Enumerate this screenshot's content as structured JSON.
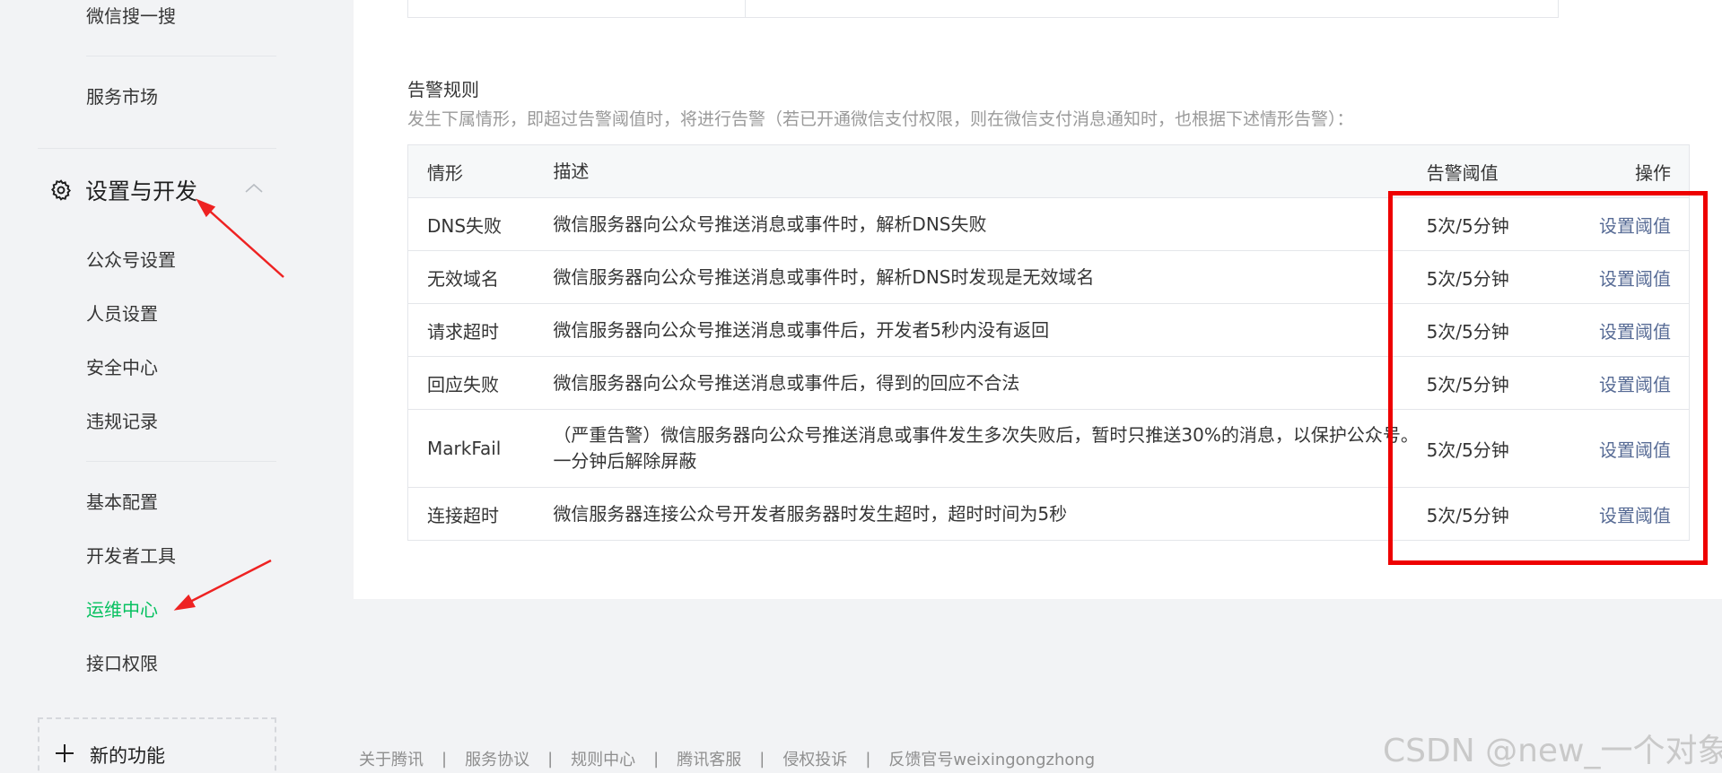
{
  "sidebar": {
    "top_items": [
      "微信搜一搜",
      "服务市场"
    ],
    "section": {
      "title": "设置与开发",
      "icon": "gear-icon",
      "collapse_icon": "chevron-up-icon"
    },
    "group1": [
      "公众号设置",
      "人员设置",
      "安全中心",
      "违规记录"
    ],
    "group2": [
      "基本配置",
      "开发者工具",
      "运维中心",
      "接口权限"
    ],
    "active_item": "运维中心",
    "new_feature": "新的功能"
  },
  "main": {
    "title": "告警规则",
    "description": "发生下属情形，即超过告警阈值时，将进行告警（若已开通微信支付权限，则在微信支付消息通知时，也根据下述情形告警）：",
    "columns": [
      "情形",
      "描述",
      "告警阈值",
      "操作"
    ],
    "rows": [
      {
        "name": "DNS失败",
        "desc": "微信服务器向公众号推送消息或事件时，解析DNS失败",
        "threshold": "5次/5分钟",
        "action": "设置阈值"
      },
      {
        "name": "无效域名",
        "desc": "微信服务器向公众号推送消息或事件时，解析DNS时发现是无效域名",
        "threshold": "5次/5分钟",
        "action": "设置阈值"
      },
      {
        "name": "请求超时",
        "desc": "微信服务器向公众号推送消息或事件后，开发者5秒内没有返回",
        "threshold": "5次/5分钟",
        "action": "设置阈值"
      },
      {
        "name": "回应失败",
        "desc": "微信服务器向公众号推送消息或事件后，得到的回应不合法",
        "threshold": "5次/5分钟",
        "action": "设置阈值"
      },
      {
        "name": "MarkFail",
        "desc": "（严重告警）微信服务器向公众号推送消息或事件发生多次失败后，暂时只推送30%的消息，以保护公众号。一分钟后解除屏蔽",
        "threshold": "5次/5分钟",
        "action": "设置阈值"
      },
      {
        "name": "连接超时",
        "desc": "微信服务器连接公众号开发者服务器时发生超时，超时时间为5秒",
        "threshold": "5次/5分钟",
        "action": "设置阈值"
      }
    ]
  },
  "footer": {
    "links": [
      "关于腾讯",
      "服务协议",
      "规则中心",
      "腾讯客服",
      "侵权投诉",
      "反馈官号weixingongzhong"
    ],
    "separator": "|"
  },
  "watermark": "CSDN @new_一个对象",
  "colors": {
    "active": "#07c160",
    "link": "#576b95",
    "annotation": "#ee0000"
  }
}
